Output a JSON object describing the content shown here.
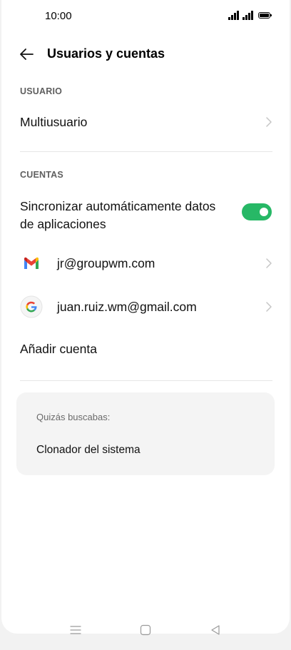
{
  "status_bar": {
    "time": "10:00"
  },
  "header": {
    "title": "Usuarios y cuentas"
  },
  "sections": {
    "usuario": {
      "label": "USUARIO",
      "multiuser_label": "Multiusuario"
    },
    "cuentas": {
      "label": "CUENTAS",
      "sync_label_line1": "Sincronizar automáticamente datos",
      "sync_label_line2": "de aplicaciones",
      "sync_enabled": true,
      "accounts": [
        {
          "icon": "gmail-icon",
          "email": "jr@groupwm.com"
        },
        {
          "icon": "google-icon",
          "email": "juan.ruiz.wm@gmail.com"
        }
      ],
      "add_account_label": "Añadir cuenta"
    }
  },
  "suggestion_card": {
    "label": "Quizás buscabas:",
    "item": "Clonador del sistema"
  },
  "colors": {
    "toggle_on": "#27b866",
    "chevron": "#c6c6c6",
    "section_label": "#5f5f5f"
  }
}
